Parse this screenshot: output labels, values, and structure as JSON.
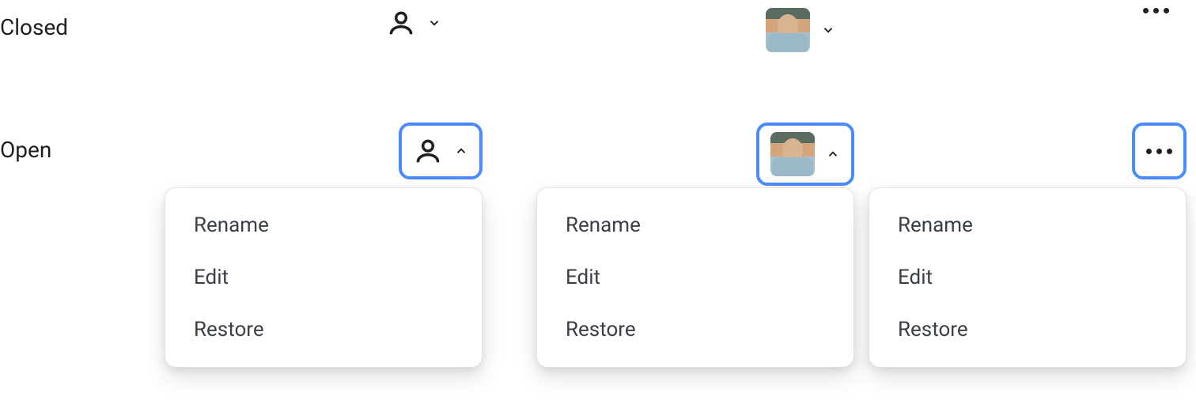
{
  "states": {
    "closed": "Closed",
    "open": "Open"
  },
  "menu": {
    "items": [
      {
        "label": "Rename"
      },
      {
        "label": "Edit"
      },
      {
        "label": "Restore"
      }
    ]
  },
  "triggers": {
    "user_icon": "user-icon",
    "avatar": "avatar",
    "more": "more-dots"
  },
  "colors": {
    "focus_ring": "#4a8cff",
    "text": "#1f1f1f",
    "menu_text": "#3a3f45",
    "menu_border": "#e1e3e6"
  }
}
